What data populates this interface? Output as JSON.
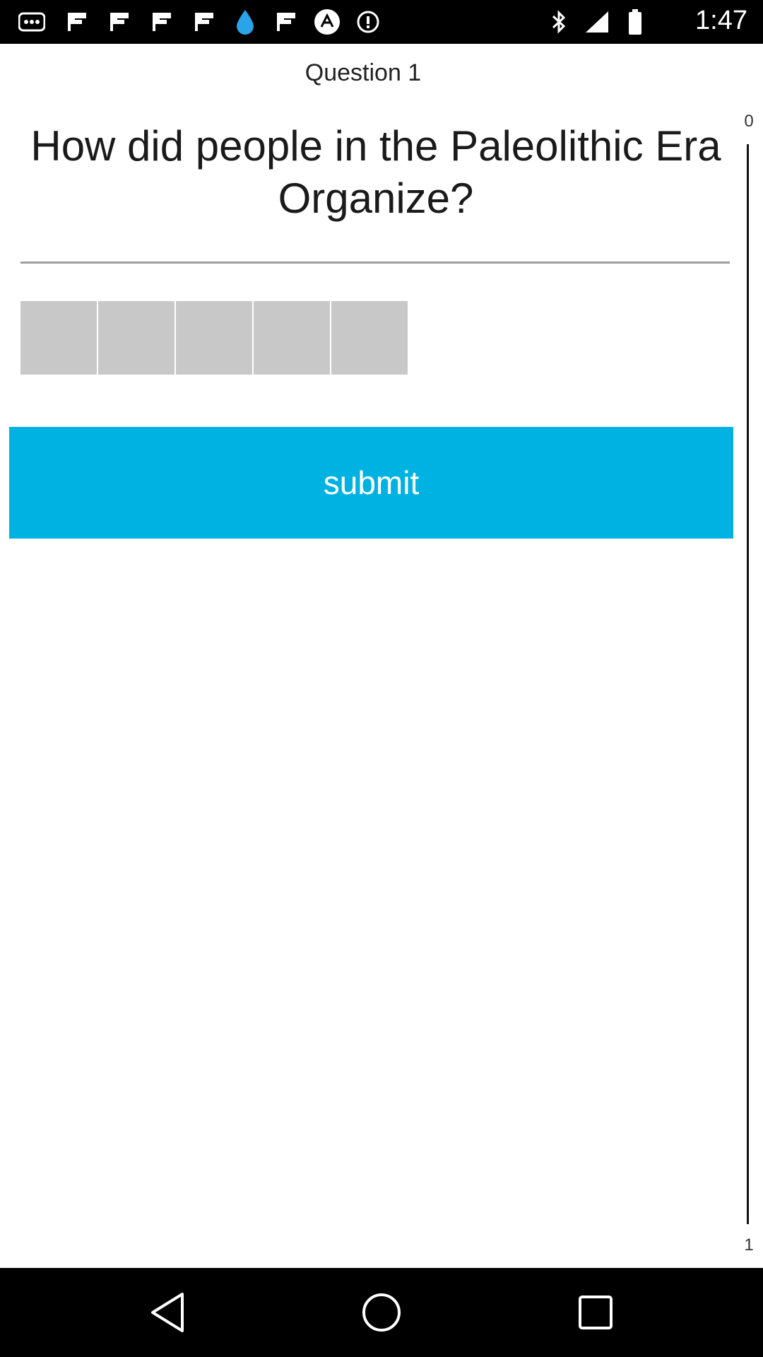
{
  "status_bar": {
    "time": "1:47",
    "icons": [
      "more-dots-icon",
      "flipboard-icon",
      "flipboard-icon",
      "flipboard-icon",
      "flipboard-icon",
      "water-drop-icon",
      "flipboard-icon",
      "app-logo-icon",
      "alert-icon",
      "bluetooth-icon",
      "signal-icon",
      "battery-icon"
    ]
  },
  "quiz": {
    "question_label": "Question 1",
    "question_text": "How did people in the Paleolithic Era Organize?",
    "answer_box_count": 5,
    "submit_label": "submit"
  },
  "progress": {
    "top_label": "0",
    "bottom_label": "1",
    "value": 0
  },
  "nav_bar": {
    "buttons": [
      "back-icon",
      "home-icon",
      "recents-icon"
    ]
  },
  "colors": {
    "accent": "#00b2e2",
    "answer_box": "#c8c8c8",
    "status_bar": "#000000"
  }
}
